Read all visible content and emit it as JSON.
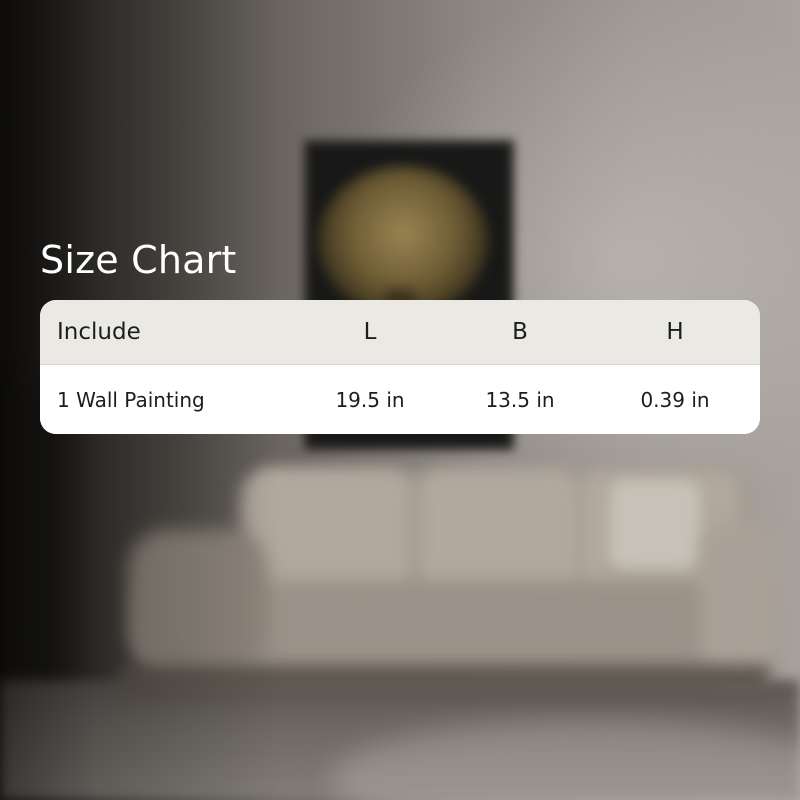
{
  "title": "Size Chart",
  "table": {
    "headers": [
      "Include",
      "L",
      "B",
      "H"
    ],
    "rows": [
      [
        "1 Wall Painting",
        "19.5 in",
        "13.5 in",
        "0.39 in"
      ]
    ]
  },
  "colors": {
    "title_text": "#ffffff",
    "header_background": "#ebe9e4",
    "body_background": "#ffffff",
    "cell_text": "#1d1d1d"
  }
}
